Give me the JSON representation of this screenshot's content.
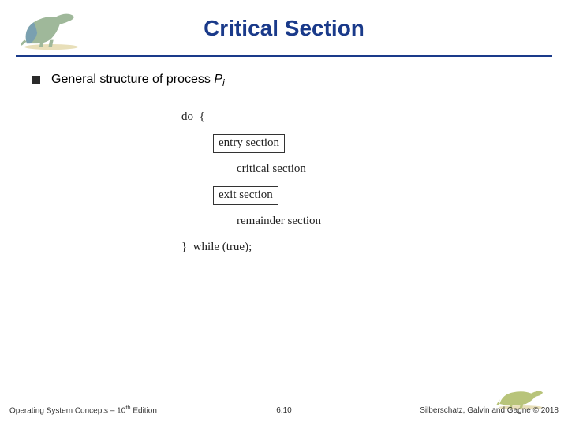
{
  "header": {
    "title": "Critical Section"
  },
  "bullet": {
    "prefix": "General structure of process ",
    "var": "P",
    "sub": "i"
  },
  "code": {
    "do_open": "do  {",
    "entry": "entry section",
    "critical": "critical section",
    "exit": "exit section",
    "remainder": "remainder section",
    "while_close": "}  while (true);"
  },
  "footer": {
    "left_pre": "Operating System Concepts – 10",
    "left_sup": "th",
    "left_post": " Edition",
    "center": "6.10",
    "right": "Silberschatz, Galvin and Gagne © 2018"
  }
}
